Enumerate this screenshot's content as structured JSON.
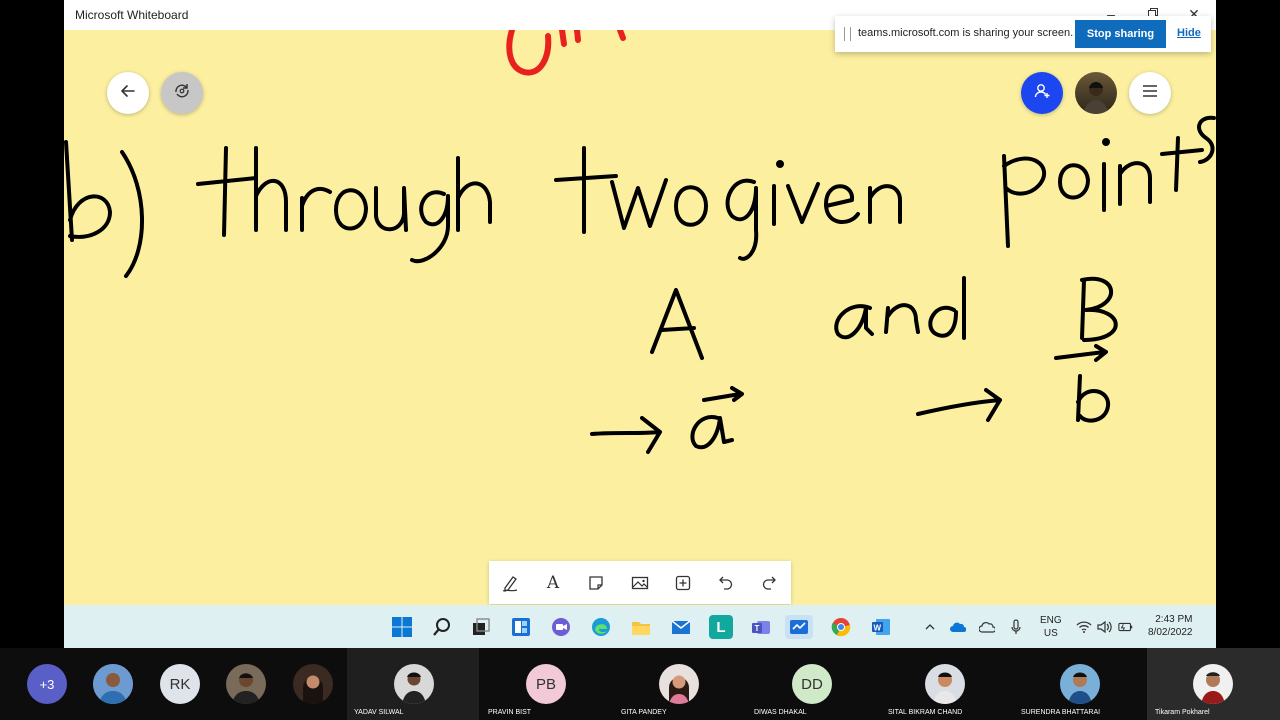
{
  "window": {
    "title": "Microsoft Whiteboard",
    "controls": [
      "minimize-icon",
      "restore-icon",
      "close-icon"
    ]
  },
  "board": {
    "background_color": "#fcf0a0",
    "ink_color": "#000000",
    "accent_ink_color": "#e8201e",
    "handwriting": {
      "line1": "b) through two given points",
      "line2": "A and B",
      "line3a": "→ a⃗",
      "line3b": "→ b⃗"
    }
  },
  "nav_buttons": {
    "back_icon": "back-arrow-icon",
    "rotate_icon": "rotate-view-icon"
  },
  "top_right": {
    "invite_icon": "add-person-icon",
    "menu_icon": "hamburger-menu-icon",
    "invite_color": "#1c46f0"
  },
  "share_bar": {
    "text": "teams.microsoft.com is sharing your screen.",
    "stop_label": "Stop sharing",
    "hide_label": "Hide"
  },
  "toolbar": {
    "tools": [
      "pen-icon",
      "text-icon",
      "sticky-note-icon",
      "image-icon",
      "add-icon",
      "undo-icon",
      "redo-icon"
    ]
  },
  "taskbar": {
    "apps": [
      "windows-start-icon",
      "search-icon",
      "task-view-icon",
      "widgets-icon",
      "chat-icon",
      "edge-icon",
      "file-explorer-icon",
      "mail-icon",
      "l-app-icon",
      "teams-icon",
      "whiteboard-icon",
      "chrome-icon",
      "word-icon"
    ],
    "tray_icons": [
      "chevron-up-icon",
      "onedrive-icon",
      "cloud-icon",
      "microphone-icon",
      "wifi-icon",
      "volume-icon",
      "battery-icon"
    ],
    "lang_line1": "ENG",
    "lang_line2": "US",
    "time": "2:43 PM",
    "date": "8/02/2022"
  },
  "participants": {
    "overflow": "+3",
    "rk_initials": "RK",
    "tiles": [
      {
        "name": "YADAV SILWAL"
      },
      {
        "name": "PRAVIN BIST",
        "initials": "PB"
      },
      {
        "name": "GITA PANDEY"
      },
      {
        "name": "DIWAS DHAKAL",
        "initials": "DD"
      },
      {
        "name": "SITAL BIKRAM CHAND"
      },
      {
        "name": "SURENDRA BHATTARAI"
      },
      {
        "name": "Tikaram  Pokharel"
      }
    ]
  }
}
